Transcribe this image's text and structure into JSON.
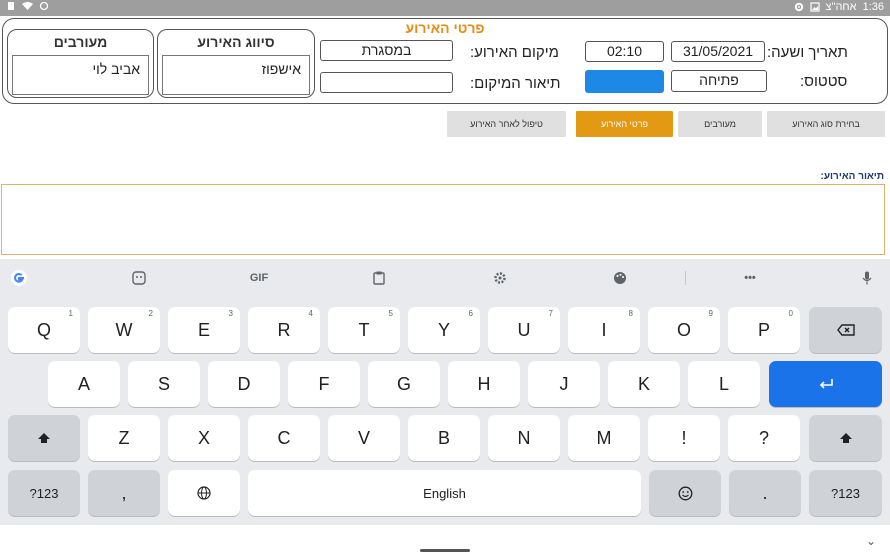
{
  "status_bar": {
    "time": "1:36",
    "date": "אחה\"צ"
  },
  "form": {
    "title": "פרטי האירוע",
    "date_time_label": "תאריך ושעה:",
    "date_value": "31/05/2021",
    "time_value": "02:10",
    "status_label": "סטטוס:",
    "status_value": "פתיחה",
    "location_label": "מיקום האירוע:",
    "location_value": "במסגרת",
    "location_desc_label": "תיאור המיקום:",
    "location_desc_value": "",
    "event_class_title": "סיווג האירוע",
    "event_class_value": "אישפוז",
    "involved_title": "מעורבים",
    "involved_value": "אביב לוי"
  },
  "tabs": [
    "בחירת סוג האירוע",
    "מעורבים",
    "פרטי האירוע",
    "טיפול לאחר האירוע"
  ],
  "active_tab": "פרטי האירוע",
  "description": {
    "label": "תיאור האירוע:",
    "value": ""
  },
  "keyboard": {
    "toolbar_icons": [
      "google-icon",
      "sticker-icon",
      "gif-icon",
      "clipboard-icon",
      "settings-icon",
      "palette-icon",
      "more-icon",
      "mic-icon"
    ],
    "gif_label": "GIF",
    "row1": [
      "Q",
      "W",
      "E",
      "R",
      "T",
      "Y",
      "U",
      "I",
      "O",
      "P"
    ],
    "row1_hints": [
      "1",
      "2",
      "3",
      "4",
      "5",
      "6",
      "7",
      "8",
      "9",
      "0"
    ],
    "row2": [
      "A",
      "S",
      "D",
      "F",
      "G",
      "H",
      "J",
      "K",
      "L"
    ],
    "row3": [
      "Z",
      "X",
      "C",
      "V",
      "B",
      "N",
      "M",
      "!",
      "?"
    ],
    "symbols_label": "?123",
    "comma": ",",
    "space_label": "English",
    "period": "."
  }
}
